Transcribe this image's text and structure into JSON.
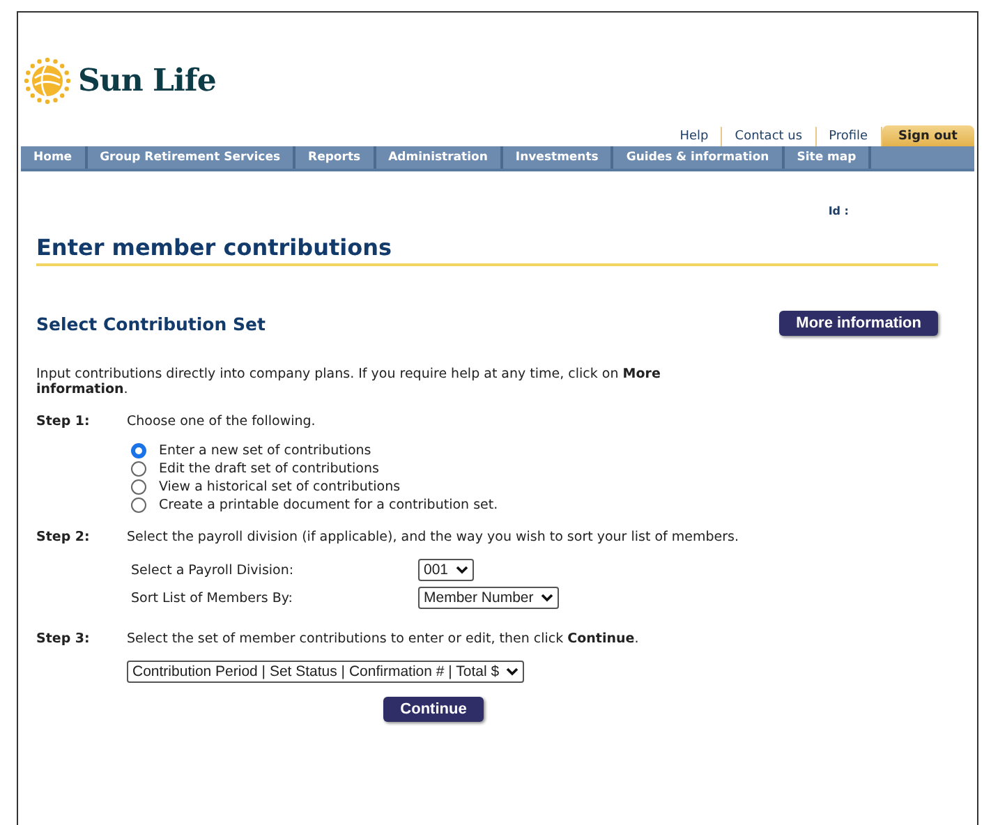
{
  "logo": {
    "text": "Sun Life"
  },
  "top_links": [
    {
      "label": "Help",
      "kind": "link"
    },
    {
      "label": "Contact us",
      "kind": "link"
    },
    {
      "label": "Profile",
      "kind": "link"
    },
    {
      "label": "Sign out",
      "kind": "tab"
    }
  ],
  "nav": [
    "Home",
    "Group Retirement Services",
    "Reports",
    "Administration",
    "Investments",
    "Guides & information",
    "Site map"
  ],
  "id_label": "Id :",
  "page_title": "Enter member contributions",
  "section_title": "Select Contribution Set",
  "more_button": "More information",
  "intro": "Input contributions directly into company plans. If you require help at any time, click on **More information**.",
  "step1": {
    "label": "Step 1:",
    "text": "Choose one of the following.",
    "options": [
      {
        "label": "Enter a new set of contributions",
        "selected": true
      },
      {
        "label": "Edit the draft set of contributions",
        "selected": false
      },
      {
        "label": "View a historical set of contributions",
        "selected": false
      },
      {
        "label": "Create a printable document for a contribution set.",
        "selected": false
      }
    ]
  },
  "step2": {
    "label": "Step 2:",
    "text": "Select the payroll division (if applicable), and the way you wish to sort your list of members.",
    "fields": [
      {
        "label": "Select a Payroll Division:",
        "value": "001"
      },
      {
        "label": "Sort List of Members By:",
        "value": "Member Number"
      }
    ]
  },
  "step3": {
    "label": "Step 3:",
    "text": "Select the set of member contributions to enter or edit, then click **Continue**.",
    "select": "Contribution Period | Set Status | Confirmation # | Total $"
  },
  "continue_button": "Continue"
}
